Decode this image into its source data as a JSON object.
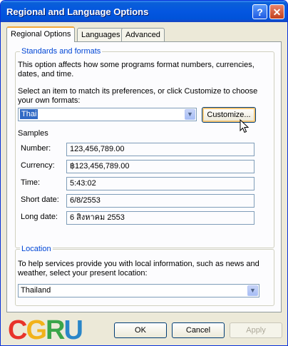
{
  "window": {
    "title": "Regional and Language Options"
  },
  "titlebar": {
    "help_glyph": "?",
    "close_glyph": "✕"
  },
  "tabs": [
    {
      "label": "Regional Options",
      "active": true
    },
    {
      "label": "Languages",
      "active": false
    },
    {
      "label": "Advanced",
      "active": false
    }
  ],
  "standards": {
    "legend": "Standards and formats",
    "description": "This option affects how some programs format numbers, currencies, dates, and time.",
    "instruction": "Select an item to match its preferences, or click Customize to choose your own formats:",
    "selected_locale": "Thai",
    "customize_label": "Customize...",
    "samples_label": "Samples",
    "samples": [
      {
        "label": "Number:",
        "value": "123,456,789.00"
      },
      {
        "label": "Currency:",
        "value": "฿123,456,789.00"
      },
      {
        "label": "Time:",
        "value": "5:43:02"
      },
      {
        "label": "Short date:",
        "value": "6/8/2553"
      },
      {
        "label": "Long date:",
        "value": "6 สิงหาคม 2553"
      }
    ]
  },
  "location": {
    "legend": "Location",
    "description": "To help services provide you with local information, such as news and weather, select your present location:",
    "selected": "Thailand"
  },
  "buttons": {
    "ok": "OK",
    "cancel": "Cancel",
    "apply": "Apply"
  },
  "watermark": {
    "text": "CGRU",
    "colors": [
      "#e8332a",
      "#f2b21a",
      "#3aa54a",
      "#2a86c8"
    ]
  },
  "accent": {
    "title_bar": "#0053d9",
    "legend_text": "#0046d5",
    "selection": "#316ac5"
  }
}
